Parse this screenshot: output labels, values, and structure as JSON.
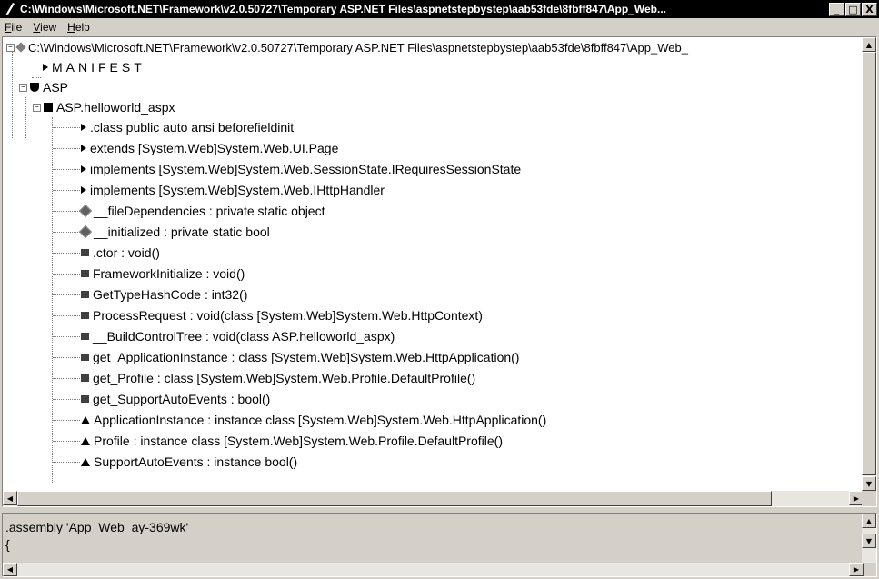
{
  "window": {
    "title": "C:\\Windows\\Microsoft.NET\\Framework\\v2.0.50727\\Temporary ASP.NET Files\\aspnetstepbystep\\aab53fde\\8fbff847\\App_Web...",
    "controls": {
      "minimize": "_",
      "maximize": "□",
      "close": "X"
    }
  },
  "menu": {
    "file": "File",
    "view": "View",
    "help": "Help"
  },
  "tree": {
    "root": "C:\\Windows\\Microsoft.NET\\Framework\\v2.0.50727\\Temporary ASP.NET Files\\aspnetstepbystep\\aab53fde\\8fbff847\\App_Web_",
    "manifest": "MANIFEST",
    "namespace": "ASP",
    "class": "ASP.helloworld_aspx",
    "members": [
      {
        "icon": "arrow",
        "label": ".class public auto ansi beforefieldinit"
      },
      {
        "icon": "arrow",
        "label": "extends [System.Web]System.Web.UI.Page"
      },
      {
        "icon": "arrow",
        "label": "implements [System.Web]System.Web.SessionState.IRequiresSessionState"
      },
      {
        "icon": "arrow",
        "label": "implements [System.Web]System.Web.IHttpHandler"
      },
      {
        "icon": "field",
        "label": "__fileDependencies : private static object"
      },
      {
        "icon": "field",
        "label": "__initialized : private static bool"
      },
      {
        "icon": "method",
        "label": ".ctor : void()"
      },
      {
        "icon": "method",
        "label": "FrameworkInitialize : void()"
      },
      {
        "icon": "method",
        "label": "GetTypeHashCode : int32()"
      },
      {
        "icon": "method",
        "label": "ProcessRequest : void(class [System.Web]System.Web.HttpContext)"
      },
      {
        "icon": "method",
        "label": "__BuildControlTree : void(class ASP.helloworld_aspx)"
      },
      {
        "icon": "method",
        "label": "get_ApplicationInstance : class [System.Web]System.Web.HttpApplication()"
      },
      {
        "icon": "method",
        "label": "get_Profile : class [System.Web]System.Web.Profile.DefaultProfile()"
      },
      {
        "icon": "method",
        "label": "get_SupportAutoEvents : bool()"
      },
      {
        "icon": "property",
        "label": "ApplicationInstance : instance class [System.Web]System.Web.HttpApplication()"
      },
      {
        "icon": "property",
        "label": "Profile : instance class [System.Web]System.Web.Profile.DefaultProfile()"
      },
      {
        "icon": "property",
        "label": "SupportAutoEvents : instance bool()"
      }
    ]
  },
  "detail": {
    "lines": [
      ".assembly 'App_Web_ay-369wk'",
      "{"
    ]
  }
}
